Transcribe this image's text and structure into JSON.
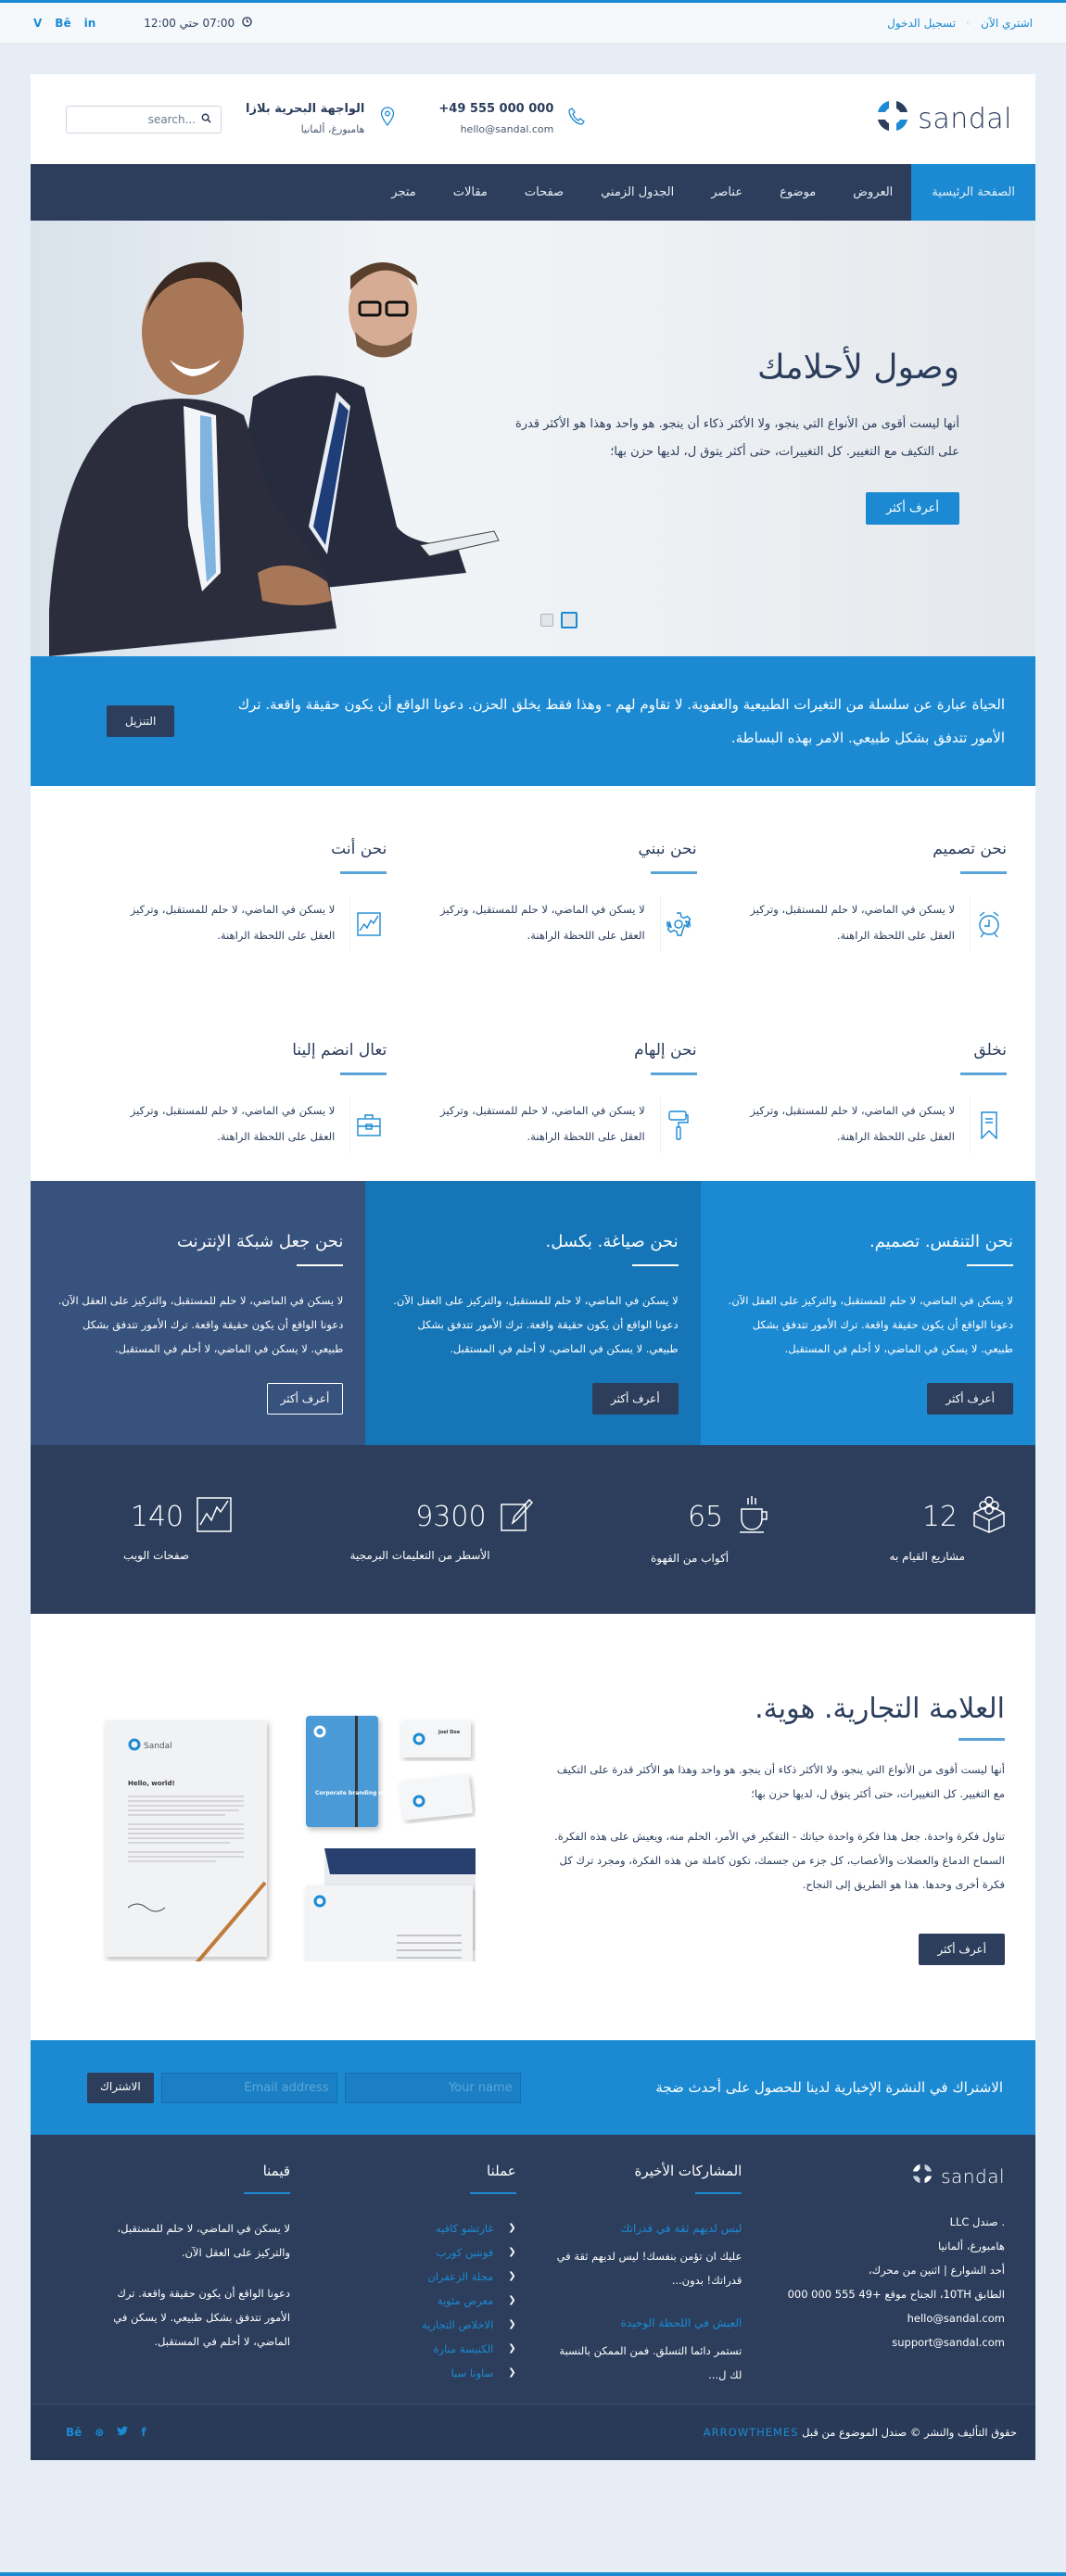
{
  "topbar": {
    "social": [
      "vine",
      "behance",
      "linkedin"
    ],
    "social_labels": {
      "vine": "V",
      "behance": "Bē",
      "linkedin": "in"
    },
    "hours": "07:00 حتي 12:00",
    "links": [
      "اشتري الآن",
      "تسجيل الدخول"
    ]
  },
  "header": {
    "logo_text": "sandal",
    "phone": "+49 555 000 000",
    "email": "hello@sandal.com",
    "address_line1": "الواجهة البحرية بلازا",
    "address_line2": "هامبورغ، ألمانيا",
    "search_placeholder": "search..."
  },
  "nav": {
    "items": [
      "الصفحة الرئيسية",
      "العروض",
      "موضوع",
      "عناصر",
      "الجدول الزمني",
      "صفحات",
      "مقالات",
      "متجر"
    ],
    "active_index": 0
  },
  "hero": {
    "title": "وصول لأحلامك",
    "body": "أنها ليست أقوى من الأنواع التي ينجو، ولا الأكثر ذكاء أن ينجو. هو واحد وهذا هو الأكثر قدرة على التكيف مع التغيير. كل التغييرات، حتى أكثر يتوق ل، لديها حزن بها؛",
    "button": "أعرف أكثر",
    "slides": 2,
    "active_slide": 2
  },
  "cta": {
    "text": "الحياة عبارة عن سلسلة من التغيرات الطبيعية والعفوية. لا تقاوم لهم - وهذا فقط يخلق الحزن. دعونا الواقع أن يكون حقيقة واقعة. ترك الأمور تتدفق بشكل طبيعي. الامر بهذه البساطة.",
    "button": "التنزيل"
  },
  "features": [
    {
      "title": "نحن تصميم",
      "icon": "alarm-clock-icon",
      "text": "لا يسكن في الماضي، لا حلم للمستقبل، وتركيز العقل على اللحظة الراهنة."
    },
    {
      "title": "نحن نبني",
      "icon": "gear-icon",
      "text": "لا يسكن في الماضي، لا حلم للمستقبل، وتركيز العقل على اللحظة الراهنة."
    },
    {
      "title": "نحن أنت",
      "icon": "chart-icon",
      "text": "لا يسكن في الماضي، لا حلم للمستقبل، وتركيز العقل على اللحظة الراهنة."
    },
    {
      "title": "نخلق",
      "icon": "bookmark-icon",
      "text": "لا يسكن في الماضي، لا حلم للمستقبل، وتركيز العقل على اللحظة الراهنة."
    },
    {
      "title": "نحن إلهام",
      "icon": "paint-roller-icon",
      "text": "لا يسكن في الماضي، لا حلم للمستقبل، وتركيز العقل على اللحظة الراهنة."
    },
    {
      "title": "تعال انضم إلينا",
      "icon": "briefcase-icon",
      "text": "لا يسكن في الماضي، لا حلم للمستقبل، وتركيز العقل على اللحظة الراهنة."
    }
  ],
  "columns": [
    {
      "title": "نحن التنفس. تصميم.",
      "text": "لا يسكن في الماضي، لا حلم للمستقبل، والتركيز على العقل الآن. دعونا الواقع أن يكون حقيقة واقعة. ترك الأمور تتدفق بشكل طبيعي. لا يسكن في الماضي، لا أحلم في المستقبل.",
      "button": "أعرف أكثر",
      "color": "#1b8ad3"
    },
    {
      "title": "نحن صياغة. بكسل.",
      "text": "لا يسكن في الماضي، لا حلم للمستقبل، والتركيز على العقل الآن. دعونا الواقع أن يكون حقيقة واقعة. ترك الأمور تتدفق بشكل طبيعي. لا يسكن في الماضي، لا أحلم في المستقبل.",
      "button": "أعرف أكثر",
      "color": "#1575b6"
    },
    {
      "title": "نحن جعل شبكة الإنترنت",
      "text": "لا يسكن في الماضي، لا حلم للمستقبل، والتركيز على العقل الآن. دعونا الواقع أن يكون حقيقة واقعة. ترك الأمور تتدفق بشكل طبيعي. لا يسكن في الماضي، لا أحلم في المستقبل.",
      "button": "أعرف أكثر",
      "color": "#36527d"
    }
  ],
  "stats": [
    {
      "value": "12",
      "label": "مشاريع القيام به",
      "icon": "blocks-icon"
    },
    {
      "value": "65",
      "label": "أكواب من القهوة",
      "icon": "coffee-cup-icon"
    },
    {
      "value": "9300",
      "label": "الأسطر من التعليمات البرمجية",
      "icon": "edit-icon"
    },
    {
      "value": "140",
      "label": "صفحات الويب",
      "icon": "chart-icon"
    }
  ],
  "brand": {
    "title": "العلامة التجارية. هوية.",
    "para1": "أنها ليست أقوى من الأنواع التي ينجو، ولا الأكثر ذكاء أن ينجو. هو واحد وهذا هو الأكثر قدرة على التكيف مع التغيير. كل التغييرات، حتى أكثر يتوق ل، لديها حزن بها؛",
    "para2": "تناول فكرة واحدة. جعل هذا فكرة واحدة حياتك - التفكير في الأمر، الحلم منه، ويعيش على هذه الفكرة. السماح الدماغ والعضلات والأعصاب، كل جزء من جسمك، تكون كاملة من هذه الفكرة، ومجرد ترك كل فكرة أخرى وحدها. هذا هو الطريق إلى النجاح.",
    "button": "أعرف أكثر",
    "mockup": {
      "letter_logo": "Sandal",
      "letter_heading": "Hello, world!",
      "notebook_text": "Corporate branding mockups",
      "card_name": "Joel Doe"
    }
  },
  "newsletter": {
    "heading": "الاشتراك في النشرة الإخبارية لدينا للحصول على أحدث ضجة",
    "name_placeholder": "Your name",
    "email_placeholder": "Email address",
    "button": "الاشتراك"
  },
  "footer": {
    "logo_text": "sandal",
    "org_lines": [
      ". صندل LLC",
      "هامبورغ، ألمانيا",
      "أحد الشوارع | اثنين من محرك،",
      "الطابق 10TH، الجناح موقع +49 555 000 000",
      "hello@sandal.com",
      "support@sandal.com"
    ],
    "posts_title": "المشاركات الأخيرة",
    "posts": [
      {
        "title": "ليس لديهم ثقة في قدراتك",
        "excerpt": "عليك ان تؤمن بنفسك! ليس لديهم ثقة في قدراتك! بدون..."
      },
      {
        "title": "العيش في اللحظة الوحيدة",
        "excerpt": "تستمر دائما التسلق. فمن الممكن بالنسبة لك ل..."
      }
    ],
    "work_title": "عملنا",
    "work_links": [
      "غارتشو كافيه",
      "فونتين كورب",
      "مجلة الزعفران",
      "معرض مئوية",
      "الاخلاص التجارية",
      "الكنيسة منارة",
      "ساونا سبا"
    ],
    "values_title": "قيمنا",
    "values_p1": "لا يسكن في الماضي، لا حلم للمستقبل، والتركيز على العقل الآن.",
    "values_p2": "دعونا الواقع أن يكون حقيقة واقعة. ترك الأمور تتدفق بشكل طبيعي. لا يسكن في الماضي، لا أحلم في المستقبل."
  },
  "bottombar": {
    "copyright": "حقوق التأليف والنشر © صندل الموضوع من قبل",
    "brand_link": "ARROWTHEMES",
    "social": [
      "behance",
      "dribbble",
      "twitter",
      "facebook"
    ],
    "social_labels": {
      "behance": "Bē",
      "dribbble": "⊛",
      "twitter": "🐦",
      "facebook": "f"
    }
  },
  "colors": {
    "accent": "#1b8ad3",
    "navy": "#2c3e5c",
    "mid_blue": "#1575b6",
    "slate_blue": "#36527d",
    "page_bg": "#e6edf4"
  }
}
